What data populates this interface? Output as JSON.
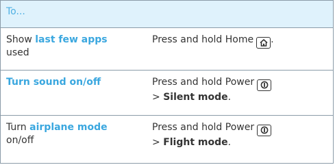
{
  "header": {
    "label": "To..."
  },
  "rows": [
    {
      "c1_before": "Show ",
      "c1_highlight": "last few apps",
      "c1_after": "used",
      "c2_before": "Press and hold Home",
      "c2_key_icon": "home-icon",
      "c2_after": "."
    },
    {
      "c1_highlight": "Turn sound on/off",
      "c2_before": "Press and hold Power",
      "c2_key_icon": "power-icon",
      "c2_line2_prefix": "> ",
      "c2_line2_bold": "Silent mode",
      "c2_line2_suffix": "."
    },
    {
      "c1_before": "Turn ",
      "c1_highlight": "airplane mode",
      "c1_after": "on/off",
      "c2_before": "Press and hold Power",
      "c2_key_icon": "power-icon",
      "c2_line2_prefix": "> ",
      "c2_line2_bold": "Flight mode",
      "c2_line2_suffix": "."
    }
  ],
  "colors": {
    "accent": "#3aa7df",
    "header_bg": "#dff2fc",
    "border": "#8a9ba8",
    "text": "#333333"
  }
}
